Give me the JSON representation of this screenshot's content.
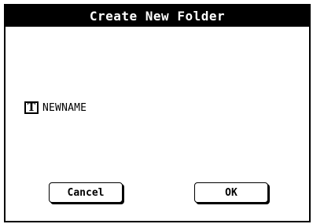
{
  "dialog": {
    "title": "Create New Folder",
    "name_field": {
      "icon": "text-edit-icon",
      "icon_glyph": "T",
      "value": "NEWNAME"
    },
    "buttons": {
      "cancel_label": "Cancel",
      "ok_label": "OK"
    }
  },
  "colors": {
    "titlebar_bg": "#000000",
    "titlebar_fg": "#ffffff",
    "background": "#ffffff"
  }
}
